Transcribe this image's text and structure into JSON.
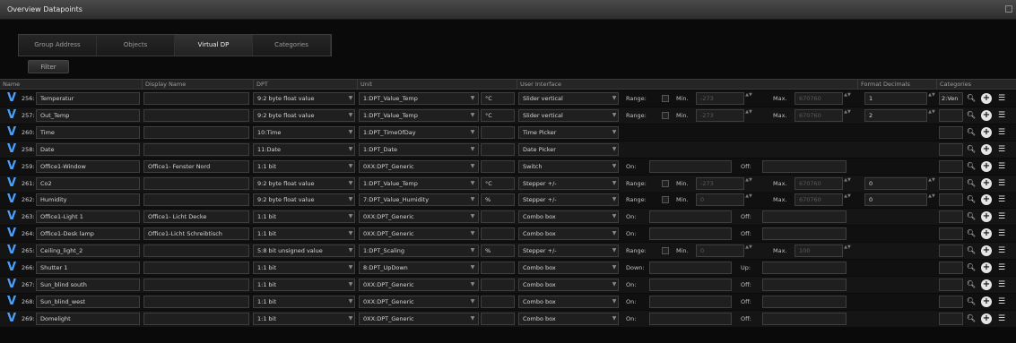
{
  "window": {
    "title": "Overview Datapoints",
    "icon": "restore-icon"
  },
  "tabs": [
    {
      "label": "Group Address",
      "active": false
    },
    {
      "label": "Objects",
      "active": false
    },
    {
      "label": "Virtual DP",
      "active": true
    },
    {
      "label": "Categories",
      "active": false
    }
  ],
  "filter_label": "Filter",
  "columns": [
    "Name",
    "Display Name",
    "DPT",
    "Unit",
    "User Interface",
    "Format Decimals",
    "Categories"
  ],
  "range_labels": {
    "range": "Range:",
    "min": "Min.",
    "max": "Max.",
    "on": "On:",
    "off": "Off:",
    "down": "Down:",
    "up": "Up:"
  },
  "rows": [
    {
      "id": "256:",
      "name": "Temperatur",
      "display": "",
      "dpt": "9:2 byte float value",
      "unit": "1:DPT_Value_Temp",
      "unit_sym": "°C",
      "ui": "Slider vertical",
      "mode": "range",
      "min": "-273",
      "max": "670760",
      "decimals": "1",
      "category": "2:Ven"
    },
    {
      "id": "257:",
      "name": "Out_Temp",
      "display": "",
      "dpt": "9:2 byte float value",
      "unit": "1:DPT_Value_Temp",
      "unit_sym": "°C",
      "ui": "Slider vertical",
      "mode": "range",
      "min": "-273",
      "max": "670760",
      "decimals": "2",
      "category": ""
    },
    {
      "id": "260:",
      "name": "Time",
      "display": "",
      "dpt": "10:Time",
      "unit": "1:DPT_TimeOfDay",
      "unit_sym": "",
      "ui": "Time Picker",
      "mode": "none",
      "category": ""
    },
    {
      "id": "258:",
      "name": "Date",
      "display": "",
      "dpt": "11:Date",
      "unit": "1:DPT_Date",
      "unit_sym": "",
      "ui": "Date Picker",
      "mode": "none",
      "category": ""
    },
    {
      "id": "259:",
      "name": "Office1-Window",
      "display": "Office1- Fenster Nord",
      "dpt": "1:1 bit",
      "unit": "0XX:DPT_Generic",
      "unit_sym": "",
      "ui": "Switch",
      "mode": "onoff",
      "category": ""
    },
    {
      "id": "261:",
      "name": "Co2",
      "display": "",
      "dpt": "9:2 byte float value",
      "unit": "1:DPT_Value_Temp",
      "unit_sym": "°C",
      "ui": "Stepper +/-",
      "mode": "range",
      "min": "-273",
      "max": "670760",
      "decimals": "0",
      "category": ""
    },
    {
      "id": "262:",
      "name": "Humidity",
      "display": "",
      "dpt": "9:2 byte float value",
      "unit": "7:DPT_Value_Humidity",
      "unit_sym": "%",
      "ui": "Stepper +/-",
      "mode": "range",
      "min": "0",
      "max": "670760",
      "decimals": "0",
      "category": ""
    },
    {
      "id": "263:",
      "name": "Office1-Light 1",
      "display": "Office1- Licht Decke",
      "dpt": "1:1 bit",
      "unit": "0XX:DPT_Generic",
      "unit_sym": "",
      "ui": "Combo box",
      "mode": "onoff",
      "category": ""
    },
    {
      "id": "264:",
      "name": "Office1-Desk lamp",
      "display": "Office1-Licht Schreibtisch",
      "dpt": "1:1 bit",
      "unit": "0XX:DPT_Generic",
      "unit_sym": "",
      "ui": "Combo box",
      "mode": "onoff",
      "category": ""
    },
    {
      "id": "265:",
      "name": "Ceiling_light_2",
      "display": "",
      "dpt": "5:8 bit unsigned value",
      "unit": "1:DPT_Scaling",
      "unit_sym": "%",
      "ui": "Stepper +/-",
      "mode": "range",
      "min": "0",
      "max": "100",
      "decimals": "",
      "category": ""
    },
    {
      "id": "266:",
      "name": "Shutter 1",
      "display": "",
      "dpt": "1:1 bit",
      "unit": "8:DPT_UpDown",
      "unit_sym": "",
      "ui": "Combo box",
      "mode": "updown",
      "category": ""
    },
    {
      "id": "267:",
      "name": "Sun_blind south",
      "display": "",
      "dpt": "1:1 bit",
      "unit": "0XX:DPT_Generic",
      "unit_sym": "",
      "ui": "Combo box",
      "mode": "onoff",
      "category": ""
    },
    {
      "id": "268:",
      "name": "Sun_blind_west",
      "display": "",
      "dpt": "1:1 bit",
      "unit": "0XX:DPT_Generic",
      "unit_sym": "",
      "ui": "Combo box",
      "mode": "onoff",
      "category": ""
    },
    {
      "id": "269:",
      "name": "Domelight",
      "display": "",
      "dpt": "1:1 bit",
      "unit": "0XX:DPT_Generic",
      "unit_sym": "",
      "ui": "Combo box",
      "mode": "onoff",
      "category": ""
    }
  ],
  "row_actions": [
    "search-icon",
    "add-icon",
    "list-icon"
  ],
  "colors": {
    "accent": "#4aa0ff",
    "background": "#0a0a0a"
  }
}
